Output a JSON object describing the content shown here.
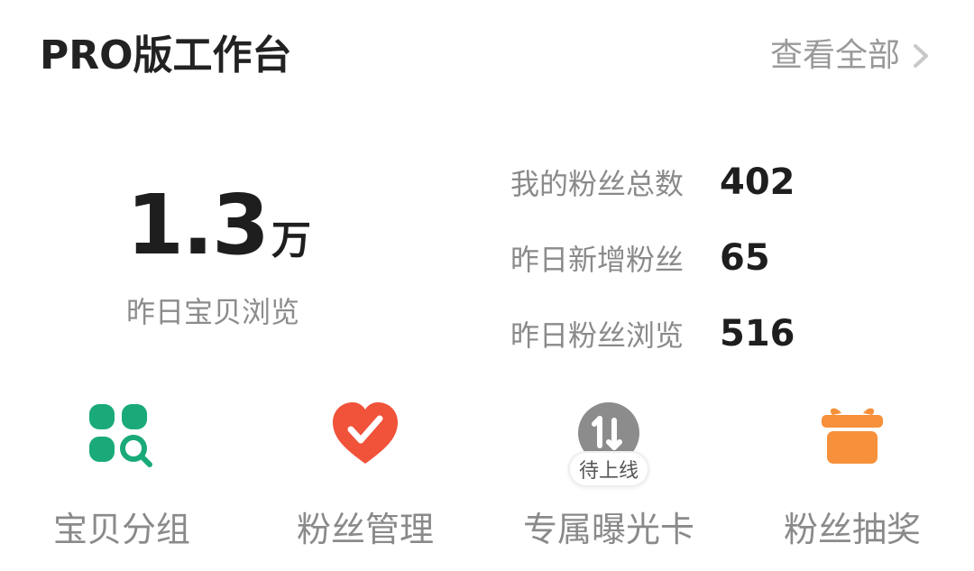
{
  "header": {
    "title": "PRO版工作台",
    "view_all": "查看全部"
  },
  "summary": {
    "value": "1.3",
    "unit": "万",
    "label": "昨日宝贝浏览"
  },
  "stats": [
    {
      "label": "我的粉丝总数",
      "value": "402"
    },
    {
      "label": "昨日新增粉丝",
      "value": "65"
    },
    {
      "label": "昨日粉丝浏览",
      "value": "516"
    }
  ],
  "tools": [
    {
      "label": "宝贝分组",
      "icon": "grid-search-icon",
      "color": "#1aaa7a"
    },
    {
      "label": "粉丝管理",
      "icon": "heart-check-icon",
      "color": "#f0523a"
    },
    {
      "label": "专属曝光卡",
      "icon": "exposure-card-icon",
      "color": "#8c8c8c",
      "badge": "待上线"
    },
    {
      "label": "粉丝抽奖",
      "icon": "gift-box-icon",
      "color": "#f7903a"
    }
  ],
  "colors": {
    "title": "#222222",
    "muted": "#8a8a8a",
    "green": "#1aaa7a",
    "red": "#f0523a",
    "gray": "#8c8c8c",
    "orange": "#f7903a"
  }
}
